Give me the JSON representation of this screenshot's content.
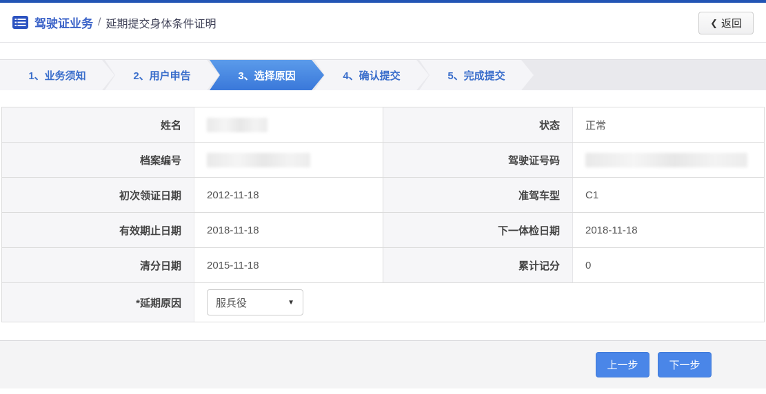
{
  "header": {
    "breadcrumb_root": "驾驶证业务",
    "breadcrumb_sep": "/",
    "breadcrumb_current": "延期提交身体条件证明",
    "back_label": "返回"
  },
  "icons": {
    "chevron_left": "❮",
    "caret_down": "▼",
    "list_icon": "list-icon"
  },
  "steps": [
    {
      "label": "1、业务须知",
      "active": false
    },
    {
      "label": "2、用户申告",
      "active": false
    },
    {
      "label": "3、选择原因",
      "active": true
    },
    {
      "label": "4、确认提交",
      "active": false
    },
    {
      "label": "5、完成提交",
      "active": false
    }
  ],
  "table": {
    "rows": [
      {
        "left": {
          "label": "姓名",
          "value": "",
          "redacted": true
        },
        "right": {
          "label": "状态",
          "value": "正常",
          "redacted": false
        }
      },
      {
        "left": {
          "label": "档案编号",
          "value": "",
          "redacted": true
        },
        "right": {
          "label": "驾驶证号码",
          "value": "",
          "redacted": true
        }
      },
      {
        "left": {
          "label": "初次领证日期",
          "value": "2012-11-18",
          "redacted": false
        },
        "right": {
          "label": "准驾车型",
          "value": "C1",
          "redacted": false
        }
      },
      {
        "left": {
          "label": "有效期止日期",
          "value": "2018-11-18",
          "redacted": false
        },
        "right": {
          "label": "下一体检日期",
          "value": "2018-11-18",
          "redacted": false
        }
      },
      {
        "left": {
          "label": "清分日期",
          "value": "2015-11-18",
          "redacted": false
        },
        "right": {
          "label": "累计记分",
          "value": "0",
          "redacted": false
        }
      }
    ],
    "reason": {
      "label": "*延期原因",
      "selected_option": "服兵役"
    }
  },
  "footer": {
    "prev_label": "上一步",
    "next_label": "下一步"
  },
  "colors": {
    "accent_blue": "#4a86e8",
    "step_active_blue": "#3a78da",
    "top_border_blue": "#2254b4",
    "link_blue": "#3a62c8"
  }
}
